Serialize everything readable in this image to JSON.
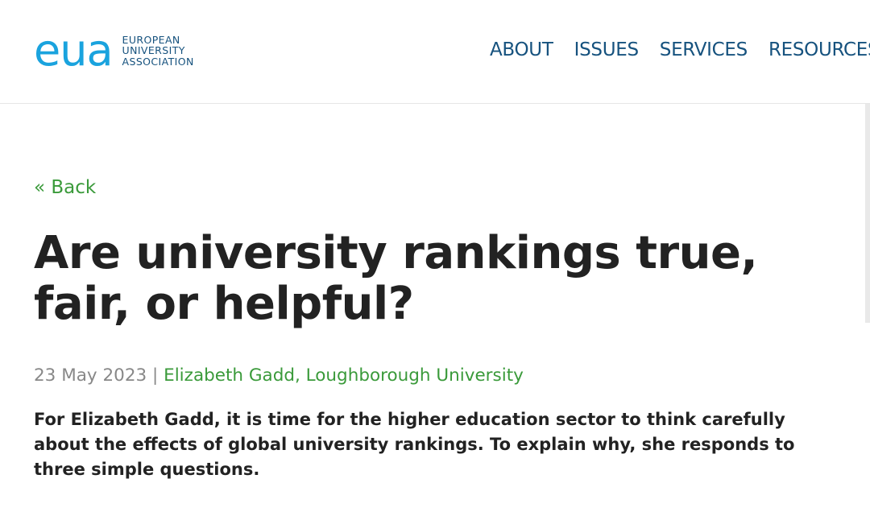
{
  "logo": {
    "mark": "eua",
    "lines": [
      "EUROPEAN",
      "UNIVERSITY",
      "ASSOCIATION"
    ]
  },
  "nav": {
    "items": [
      {
        "label": "ABOUT"
      },
      {
        "label": "ISSUES"
      },
      {
        "label": "SERVICES"
      },
      {
        "label": "RESOURCES"
      }
    ]
  },
  "article": {
    "back_label": "« Back",
    "title": "Are university rankings true, fair, or helpful?",
    "date": "23 May 2023",
    "separator": " | ",
    "author": "Elizabeth Gadd, Loughborough University",
    "lead": "For Elizabeth Gadd, it is time for the higher education sector to think carefully about the effects of global university rankings. To explain why, she responds to three simple questions."
  },
  "colors": {
    "brand_blue": "#1aa3de",
    "nav_blue": "#16527e",
    "link_green": "#3a9a3a"
  }
}
